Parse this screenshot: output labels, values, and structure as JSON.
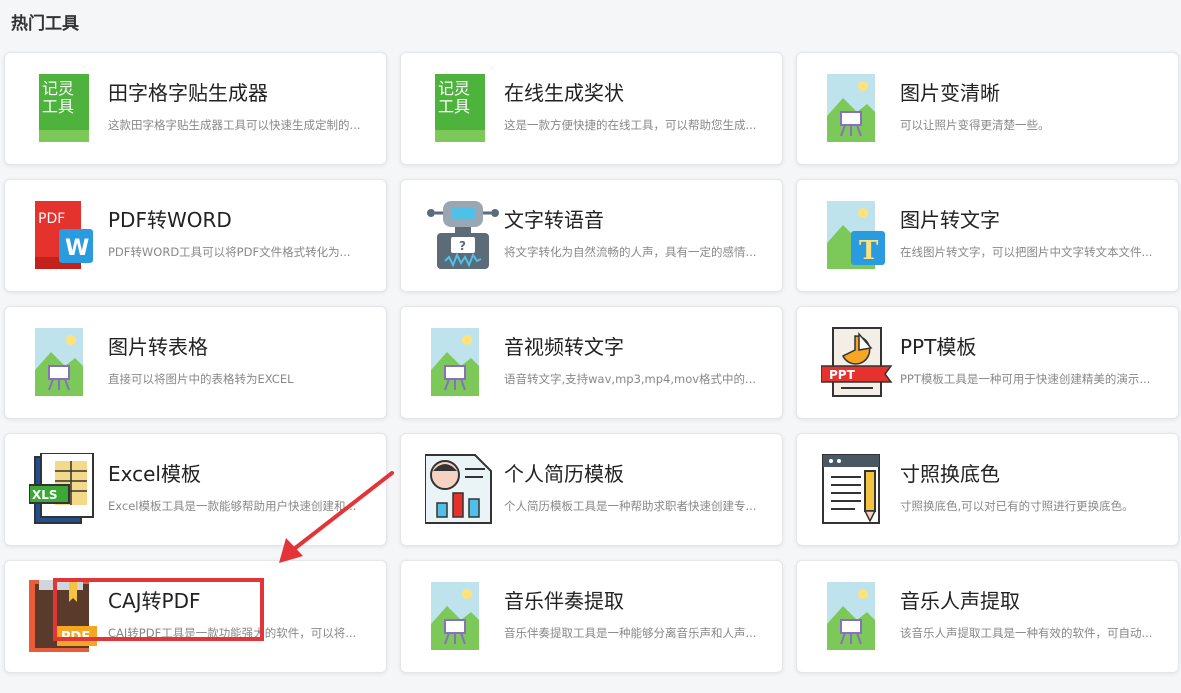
{
  "section": {
    "title": "热门工具"
  },
  "tools": [
    {
      "title": "田字格字贴生成器",
      "desc": "这款田字格字贴生成器工具可以快速生成定制的...",
      "icon": "jilin-tool-icon",
      "icon_text": [
        "记灵",
        "工具"
      ]
    },
    {
      "title": "在线生成奖状",
      "desc": "这是一款方便快捷的在线工具，可以帮助您生成...",
      "icon": "jilin-tool-icon",
      "icon_text": [
        "记灵",
        "工具"
      ]
    },
    {
      "title": "图片变清晰",
      "desc": "可以让照片变得更清楚一些。",
      "icon": "landscape-image-icon"
    },
    {
      "title": "PDF转WORD",
      "desc": "PDF转WORD工具可以将PDF文件格式转化为...",
      "icon": "pdf-to-word-icon",
      "icon_text": [
        "PDF",
        "W"
      ]
    },
    {
      "title": "文字转语音",
      "desc": "将文字转化为自然流畅的人声，具有一定的感情...",
      "icon": "robot-icon"
    },
    {
      "title": "图片转文字",
      "desc": "在线图片转文字，可以把图片中文字转文本文件...",
      "icon": "image-to-text-icon",
      "icon_text": [
        "T"
      ]
    },
    {
      "title": "图片转表格",
      "desc": "直接可以将图片中的表格转为EXCEL",
      "icon": "landscape-image-icon"
    },
    {
      "title": "音视频转文字",
      "desc": "语音转文字,支持wav,mp3,mp4,mov格式中的...",
      "icon": "landscape-image-icon"
    },
    {
      "title": "PPT模板",
      "desc": "PPT模板工具是一种可用于快速创建精美的演示...",
      "icon": "ppt-template-icon",
      "icon_text": [
        "PPT"
      ]
    },
    {
      "title": "Excel模板",
      "desc": "Excel模板工具是一款能够帮助用户快速创建和...",
      "icon": "excel-template-icon",
      "icon_text": [
        "XLS"
      ]
    },
    {
      "title": "个人简历模板",
      "desc": "个人简历模板工具是一种帮助求职者快速创建专...",
      "icon": "resume-icon"
    },
    {
      "title": "寸照换底色",
      "desc": "寸照换底色,可以对已有的寸照进行更换底色。",
      "icon": "document-pen-icon"
    },
    {
      "title": "CAJ转PDF",
      "desc": "CAJ转PDF工具是一款功能强大的软件，可以将...",
      "icon": "caj-book-icon",
      "icon_text": [
        "PDF"
      ]
    },
    {
      "title": "音乐伴奏提取",
      "desc": "音乐伴奏提取工具是一种能够分离音乐声和人声...",
      "icon": "landscape-image-icon"
    },
    {
      "title": "音乐人声提取",
      "desc": "该音乐人声提取工具是一种有效的软件，可自动...",
      "icon": "landscape-image-icon"
    }
  ],
  "colors": {
    "annotation": "#e33437",
    "jilin_green": "#3aa935",
    "pdf_red": "#e5322d",
    "word_blue": "#2b9be0"
  }
}
